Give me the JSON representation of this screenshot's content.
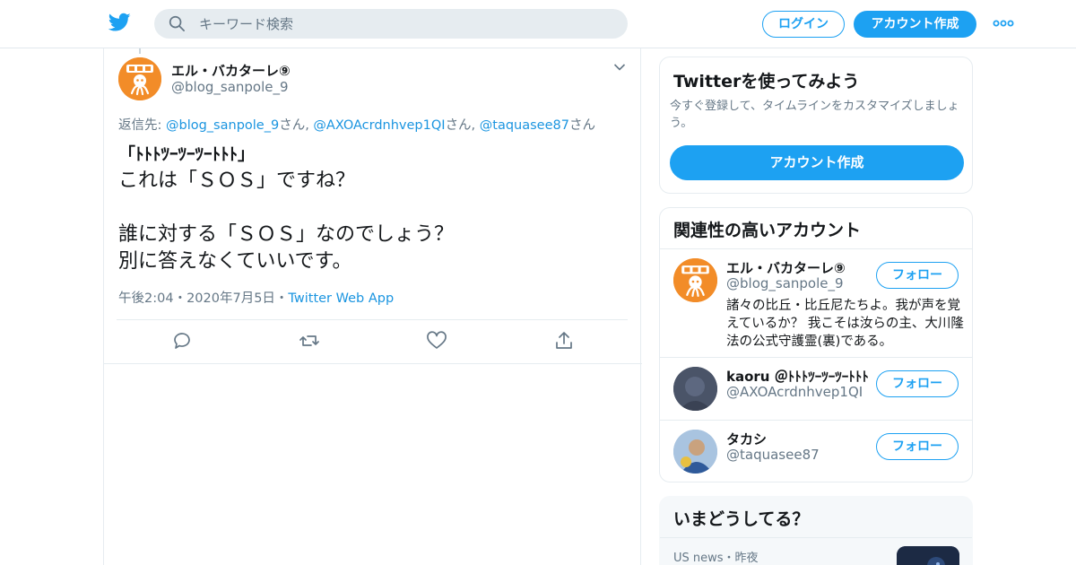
{
  "header": {
    "search_placeholder": "キーワード検索",
    "login_label": "ログイン",
    "signup_label": "アカウント作成"
  },
  "tweet": {
    "author_name": "エル・バカターレ⑨",
    "author_handle": "@blog_sanpole_9",
    "reply_prefix": "返信先: ",
    "reply_1": "@blog_sanpole_9",
    "reply_sep_1": "さん, ",
    "reply_2": "@AXOAcrdnhvep1QI",
    "reply_sep_2": "さん, ",
    "reply_3": "@taquasee87",
    "reply_suffix": "さん",
    "lines": [
      "「ﾄﾄﾄﾂｰﾂｰﾂｰﾄﾄﾄ」",
      "これは「ＳＯＳ」ですね？",
      "",
      "誰に対する「ＳＯＳ」なのでしょう？",
      "別に答えなくていいです。"
    ],
    "time": "午後2:04",
    "dot": "・",
    "date": "2020年7月5日",
    "source": "Twitter Web App"
  },
  "signup_card": {
    "title": "Twitterを使ってみよう",
    "description": "今すぐ登録して、タイムラインをカスタマイズしましょう。",
    "button": "アカウント作成"
  },
  "related": {
    "title": "関連性の高いアカウント",
    "follow_label": "フォロー",
    "accounts": [
      {
        "name": "エル・バカターレ⑨",
        "handle": "@blog_sanpole_9",
        "bio": "諸々の比丘・比丘尼たちよ。我が声を覚えているか？ 我こそは汝らの主、大川隆法の公式守護霊(裏)である。"
      },
      {
        "name": "kaoru ＠ﾄﾄﾄﾂｰﾂｰﾂｰﾄﾄﾄ",
        "handle": "@AXOAcrdnhvep1QI",
        "bio": ""
      },
      {
        "name": "タカシ",
        "handle": "@taquasee87",
        "bio": ""
      }
    ]
  },
  "trends": {
    "title": "いまどうしてる？",
    "meta": "US news・昨夜"
  },
  "colors": {
    "accent": "#1da1f2",
    "link": "#1b95e0",
    "muted": "#657786",
    "avatar_orange": "#f28c28"
  }
}
